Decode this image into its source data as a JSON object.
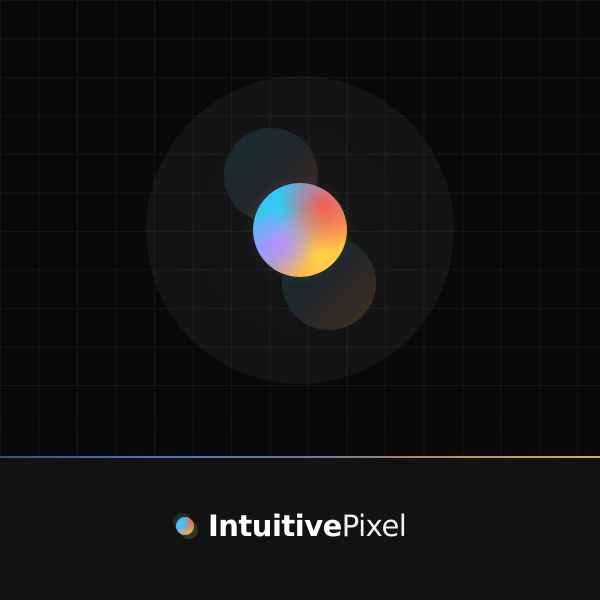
{
  "brand": {
    "name_bold": "Intuitive",
    "name_light": "Pixel",
    "icon": "orb-logo-icon"
  },
  "colors": {
    "background": "#0a0a0a",
    "footer": "#121212",
    "divider_start": "#2a5f8f",
    "divider_end": "#f0c060",
    "orb_cyan": "#2ab8f0",
    "orb_red": "#ff5a46",
    "orb_yellow": "#ffd04a",
    "orb_violet": "#be8cff"
  },
  "graphic": {
    "icon": "floating-orbs-graphic"
  }
}
